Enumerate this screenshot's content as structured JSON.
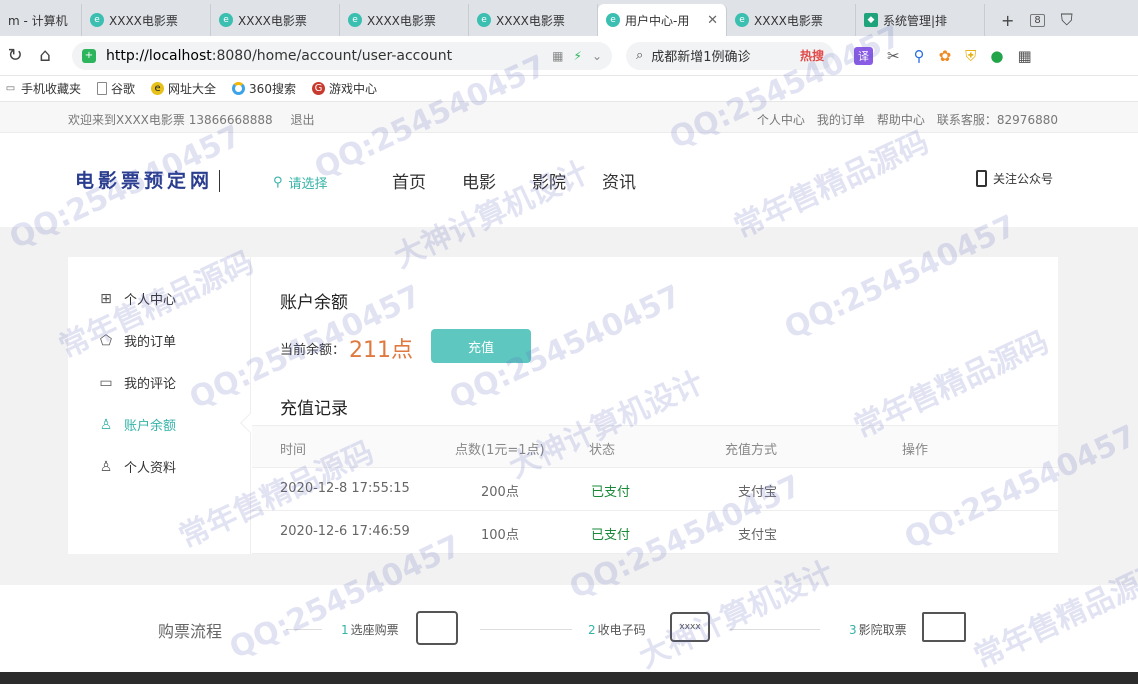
{
  "browser": {
    "tabs": [
      {
        "label": "m - 计算机",
        "active": false
      },
      {
        "label": "XXXX电影票",
        "active": false
      },
      {
        "label": "XXXX电影票",
        "active": false
      },
      {
        "label": "XXXX电影票",
        "active": false
      },
      {
        "label": "XXXX电影票",
        "active": false
      },
      {
        "label": "用户中心-用",
        "active": true
      },
      {
        "label": "XXXX电影票",
        "active": false
      },
      {
        "label": "系统管理|排",
        "active": false
      }
    ],
    "tab_count": "8",
    "url_host": "http://localhost",
    "url_rest": ":8080/home/account/user-account",
    "search_text": "成都新增1例确诊",
    "hot_label": "热搜",
    "translate_label": "译",
    "bookmarks": [
      {
        "label": "手机收藏夹",
        "icon": "folder-icon"
      },
      {
        "label": "谷歌",
        "icon": "page-icon"
      },
      {
        "label": "网址大全",
        "icon": "nav-icon"
      },
      {
        "label": "360搜索",
        "icon": "360-icon"
      },
      {
        "label": "游戏中心",
        "icon": "game-icon"
      }
    ]
  },
  "site": {
    "welcome": "欢迎来到XXXX电影票 13866668888",
    "logout": "退出",
    "top_links": [
      "个人中心",
      "我的订单",
      "帮助中心",
      "联系客服：82976880"
    ],
    "logo": "电影票预定网",
    "city": "请选择",
    "nav": [
      "首页",
      "电影",
      "影院",
      "资讯"
    ],
    "follow": "关注公众号"
  },
  "sidebar": [
    {
      "label": "个人中心",
      "icon": "grid-icon",
      "active": false
    },
    {
      "label": "我的订单",
      "icon": "bag-icon",
      "active": false
    },
    {
      "label": "我的评论",
      "icon": "comment-icon",
      "active": false
    },
    {
      "label": "账户余额",
      "icon": "wallet-icon",
      "active": true
    },
    {
      "label": "个人资料",
      "icon": "user-icon",
      "active": false
    }
  ],
  "account": {
    "title": "账户余额",
    "balance_label": "当前余额：",
    "balance_value": "211点",
    "recharge_button": "充值",
    "records_title": "充值记录",
    "columns": [
      "时间",
      "点数(1元=1点)",
      "状态",
      "充值方式",
      "操作"
    ],
    "rows": [
      [
        "2020-12-8 17:55:15",
        "200点",
        "已支付",
        "支付宝",
        ""
      ],
      [
        "2020-12-6 17:46:59",
        "100点",
        "已支付",
        "支付宝",
        ""
      ]
    ]
  },
  "flow": {
    "title": "购票流程",
    "steps": [
      {
        "num": "1",
        "label": "选座购票"
      },
      {
        "num": "2",
        "label": "收电子码"
      },
      {
        "num": "3",
        "label": "影院取票"
      }
    ],
    "code_text": "xxxx"
  },
  "watermarks": [
    "QQ:254540457",
    "常年售精品源码",
    "大神计算机设计"
  ],
  "colors": {
    "accent": "#36b3a8",
    "button": "#5ec8c0",
    "amount": "#e0793f",
    "paid": "#1a8a3a",
    "logo": "#2a3d8f"
  }
}
